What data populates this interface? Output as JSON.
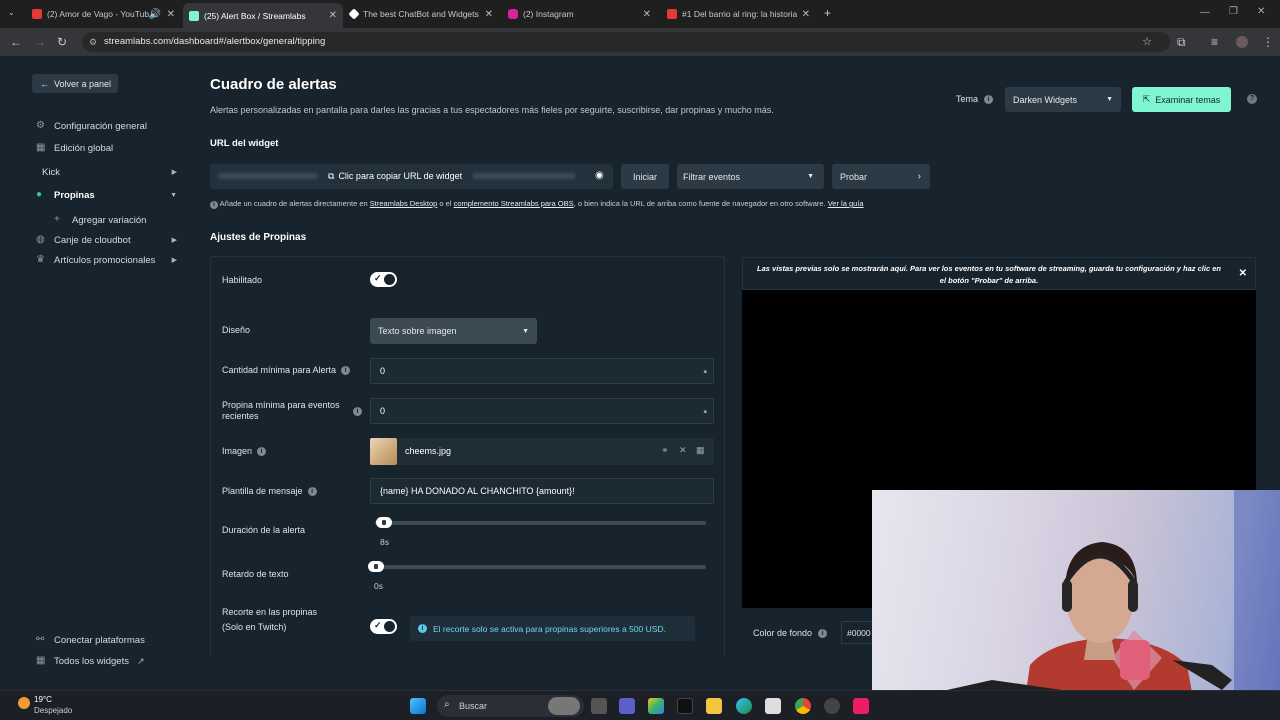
{
  "browser": {
    "tabs": [
      {
        "label": "(2) Amor de Vago - YouTub",
        "fav": "#e53935"
      },
      {
        "label": "(25) Alert Box / Streamlabs",
        "fav": "#80f5d2"
      },
      {
        "label": "The best ChatBot and Widgets",
        "fav": "#ffffff"
      },
      {
        "label": "(2) Instagram",
        "fav": "#d6249f"
      },
      {
        "label": "#1 Del barrio al ring: la historia",
        "fav": "#e53935"
      }
    ],
    "url": "streamlabs.com/dashboard#/alertbox/general/tipping"
  },
  "sidebar": {
    "back": "Volver a panel",
    "items": [
      {
        "label": "Configuración general",
        "icon": "gear-icon"
      },
      {
        "label": "Edición global",
        "icon": "grid-icon"
      },
      {
        "label": "Kick",
        "icon": ""
      },
      {
        "label": "Propinas",
        "icon": "tip-icon"
      },
      {
        "label": "Agregar variación",
        "icon": "plus-icon"
      },
      {
        "label": "Canje de cloudbot",
        "icon": "cloudbot-icon"
      },
      {
        "label": "Artículos promocionales",
        "icon": "merch-icon"
      }
    ],
    "bottom": [
      {
        "label": "Conectar plataformas",
        "icon": "link-icon"
      },
      {
        "label": "Todos los widgets",
        "icon": "grid-icon"
      }
    ]
  },
  "header": {
    "title": "Cuadro de alertas",
    "subtitle": "Alertas personalizadas en pantalla para darles las gracias a tus espectadores más fieles por seguirte, suscribirse, dar propinas y mucho más.",
    "tema_label": "Tema",
    "tema_value": "Darken Widgets",
    "examine_button": "Examinar temas"
  },
  "widget_url": {
    "label": "URL del widget",
    "copy_text": "Clic para copiar URL de widget",
    "start_button": "Iniciar",
    "filter_label": "Filtrar eventos",
    "test_button": "Probar",
    "note_prefix": "Añade un cuadro de alertas directamente en",
    "note_link1": "Streamlabs Desktop",
    "note_mid": "o el",
    "note_link2": "complemento Streamlabs para OBS",
    "note_suffix": ", o bien indica la URL de arriba como fuente de navegador en otro software.",
    "note_link3": "Ver la guía"
  },
  "settings": {
    "section_title": "Ajustes de Propinas",
    "enabled_label": "Habilitado",
    "design_label": "Diseño",
    "design_value": "Texto sobre imagen",
    "min_amount_label": "Cantidad mínima para Alerta",
    "min_amount_value": "0",
    "min_recent_label": "Propina mínima para eventos recientes",
    "min_recent_value": "0",
    "image_label": "Imagen",
    "image_file": "cheems.jpg",
    "message_label": "Plantilla de mensaje",
    "message_value": "{name} HA DONADO AL CHANCHITO {amount}!",
    "duration_label": "Duración de la alerta",
    "duration_value": "8s",
    "duration_level": 0.01,
    "delay_label": "Retardo de texto",
    "delay_value": "0s",
    "delay_level": 0,
    "cut_label": "Recorte en las propinas (Solo en Twitch)",
    "cut_info": "El recorte solo se activa para propinas superiores a 500 USD."
  },
  "preview": {
    "message": "Las vistas previas solo se mostrarán aquí. Para ver los eventos en tu software de streaming, guarda tu configuración y haz clic en el botón \"Probar\" de arriba.",
    "bg_color_label": "Color de fondo",
    "bg_color_value": "#0000"
  },
  "taskbar": {
    "weather_temp": "19°C",
    "weather_desc": "Despejado",
    "search": "Buscar"
  },
  "colors": {
    "accent": "#80f5d2",
    "background": "#17242d",
    "panel": "#2b3a44"
  }
}
